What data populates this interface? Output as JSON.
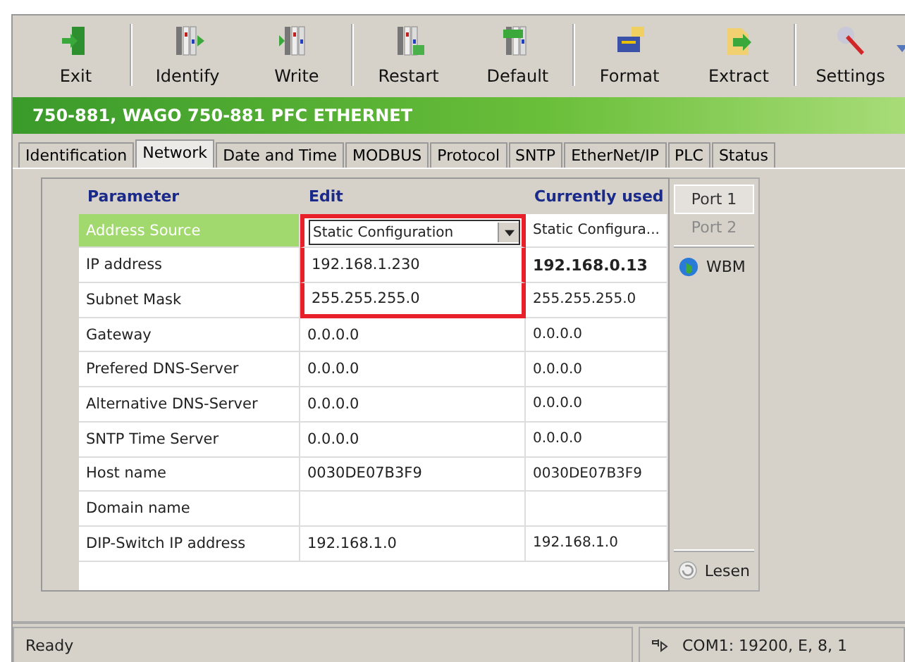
{
  "toolbar": [
    {
      "label": "Exit",
      "kind": "exit"
    },
    {
      "label": "Identify",
      "kind": "identify"
    },
    {
      "label": "Write",
      "kind": "write"
    },
    {
      "label": "Restart",
      "kind": "restart"
    },
    {
      "label": "Default",
      "kind": "default"
    },
    {
      "label": "Format",
      "kind": "format"
    },
    {
      "label": "Extract",
      "kind": "extract"
    },
    {
      "label": "Settings",
      "kind": "settings"
    }
  ],
  "device_title": "750-881, WAGO 750-881 PFC ETHERNET",
  "tabs": [
    {
      "label": "Identification",
      "selected": false
    },
    {
      "label": "Network",
      "selected": true
    },
    {
      "label": "Date and Time",
      "selected": false
    },
    {
      "label": "MODBUS",
      "selected": false
    },
    {
      "label": "Protocol",
      "selected": false
    },
    {
      "label": "SNTP",
      "selected": false
    },
    {
      "label": "EtherNet/IP",
      "selected": false
    },
    {
      "label": "PLC",
      "selected": false
    },
    {
      "label": "Status",
      "selected": false
    }
  ],
  "table": {
    "columns": [
      "Parameter",
      "Edit",
      "Currently used"
    ],
    "rows": [
      {
        "parameter": "Address Source",
        "edit": "Static Configuration",
        "kind": "dropdown",
        "current": "Static Configura...",
        "selected": true,
        "highlighted": true,
        "current_bold": false
      },
      {
        "parameter": "IP address",
        "edit": "192.168.1.230",
        "kind": "text",
        "current": "192.168.0.13",
        "selected": false,
        "highlighted": true,
        "current_bold": true
      },
      {
        "parameter": "Subnet Mask",
        "edit": "255.255.255.0",
        "kind": "text",
        "current": "255.255.255.0",
        "selected": false,
        "highlighted": true,
        "current_bold": false
      },
      {
        "parameter": "Gateway",
        "edit": "0.0.0.0",
        "kind": "text",
        "current": "0.0.0.0",
        "selected": false,
        "highlighted": false,
        "current_bold": false
      },
      {
        "parameter": "Prefered DNS-Server",
        "edit": "0.0.0.0",
        "kind": "text",
        "current": "0.0.0.0",
        "selected": false,
        "highlighted": false,
        "current_bold": false
      },
      {
        "parameter": "Alternative DNS-Server",
        "edit": "0.0.0.0",
        "kind": "text",
        "current": "0.0.0.0",
        "selected": false,
        "highlighted": false,
        "current_bold": false
      },
      {
        "parameter": "SNTP Time Server",
        "edit": "0.0.0.0",
        "kind": "text",
        "current": "0.0.0.0",
        "selected": false,
        "highlighted": false,
        "current_bold": false
      },
      {
        "parameter": "Host name",
        "edit": "0030DE07B3F9",
        "kind": "text",
        "current": "0030DE07B3F9",
        "selected": false,
        "highlighted": false,
        "current_bold": false
      },
      {
        "parameter": "Domain name",
        "kind": "text",
        "selected": false,
        "highlighted": false
      },
      {
        "parameter": "DIP-Switch IP address",
        "edit": "192.168.1.0",
        "kind": "text",
        "current": "192.168.1.0",
        "selected": false,
        "highlighted": false,
        "current_bold": false
      }
    ]
  },
  "ports": [
    {
      "label": "Port 1",
      "selected": true,
      "disabled": false
    },
    {
      "label": "Port 2",
      "selected": false,
      "disabled": true
    }
  ],
  "wbm_label": "WBM",
  "read_button": "Lesen",
  "status_bar": {
    "message": "Ready",
    "connection": "COM1: 19200, E, 8, 1"
  }
}
